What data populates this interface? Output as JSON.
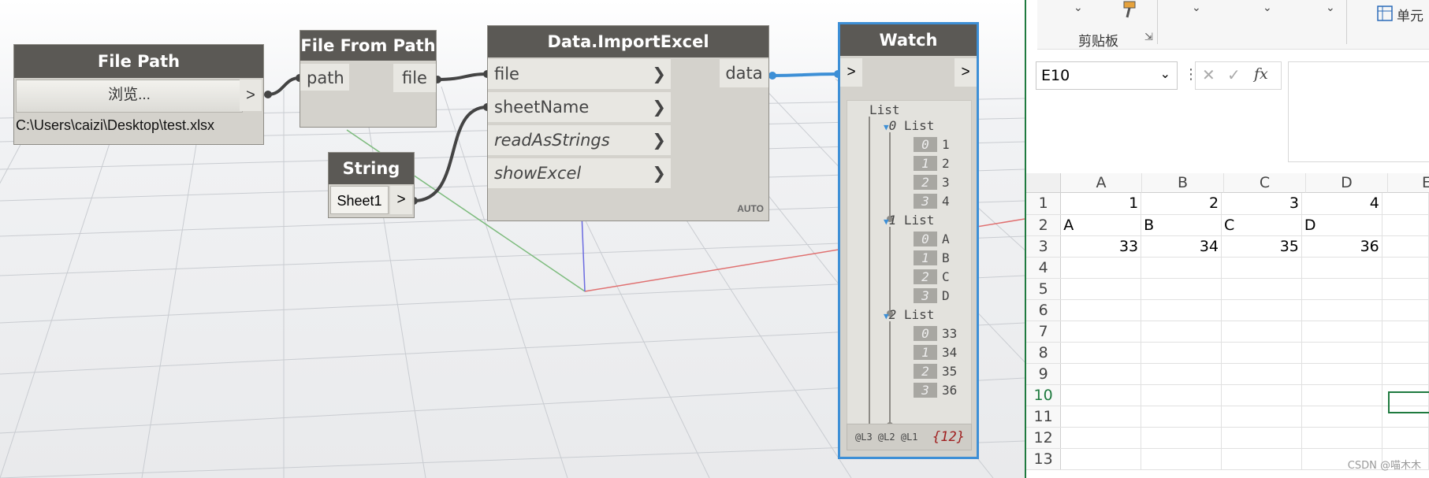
{
  "nodes": {
    "file_path": {
      "title": "File Path",
      "browse_label": "浏览...",
      "output_arrow": ">",
      "path_value": "C:\\Users\\caizi\\Desktop\\test.xlsx"
    },
    "file_from_path": {
      "title": "File From Path",
      "input": "path",
      "output": "file"
    },
    "string": {
      "title": "String",
      "value": "Sheet1",
      "output_arrow": ">"
    },
    "import_excel": {
      "title": "Data.ImportExcel",
      "inputs": [
        "file",
        "sheetName",
        "readAsStrings",
        "showExcel"
      ],
      "output": "data",
      "mode": "AUTO"
    },
    "watch": {
      "title": "Watch",
      "in_arrow": ">",
      "out_arrow": ">",
      "root_label": "List",
      "groups": [
        {
          "index": "0",
          "label": "List",
          "items": [
            {
              "i": "0",
              "v": "1"
            },
            {
              "i": "1",
              "v": "2"
            },
            {
              "i": "2",
              "v": "3"
            },
            {
              "i": "3",
              "v": "4"
            }
          ]
        },
        {
          "index": "1",
          "label": "List",
          "items": [
            {
              "i": "0",
              "v": "A"
            },
            {
              "i": "1",
              "v": "B"
            },
            {
              "i": "2",
              "v": "C"
            },
            {
              "i": "3",
              "v": "D"
            }
          ]
        },
        {
          "index": "2",
          "label": "List",
          "items": [
            {
              "i": "0",
              "v": "33"
            },
            {
              "i": "1",
              "v": "34"
            },
            {
              "i": "2",
              "v": "35"
            },
            {
              "i": "3",
              "v": "36"
            }
          ]
        }
      ],
      "levels": [
        "@L3",
        "@L2",
        "@L1"
      ],
      "count": "{12}"
    }
  },
  "excel": {
    "ribbon_group": "剪贴板",
    "ribbon_partial": "单元",
    "name_box": "E10",
    "fx": "fx",
    "columns": [
      "A",
      "B",
      "C",
      "D",
      "E"
    ],
    "rows": [
      {
        "n": "1",
        "cells": [
          "1",
          "2",
          "3",
          "4"
        ]
      },
      {
        "n": "2",
        "cells": [
          "A",
          "B",
          "C",
          "D"
        ]
      },
      {
        "n": "3",
        "cells": [
          "33",
          "34",
          "35",
          "36"
        ]
      },
      {
        "n": "4",
        "cells": [
          "",
          "",
          "",
          ""
        ]
      },
      {
        "n": "5",
        "cells": [
          "",
          "",
          "",
          ""
        ]
      },
      {
        "n": "6",
        "cells": [
          "",
          "",
          "",
          ""
        ]
      },
      {
        "n": "7",
        "cells": [
          "",
          "",
          "",
          ""
        ]
      },
      {
        "n": "8",
        "cells": [
          "",
          "",
          "",
          ""
        ]
      },
      {
        "n": "9",
        "cells": [
          "",
          "",
          "",
          ""
        ]
      },
      {
        "n": "10",
        "cells": [
          "",
          "",
          "",
          ""
        ]
      },
      {
        "n": "11",
        "cells": [
          "",
          "",
          "",
          ""
        ]
      },
      {
        "n": "12",
        "cells": [
          "",
          "",
          "",
          ""
        ]
      },
      {
        "n": "13",
        "cells": [
          "",
          "",
          "",
          ""
        ]
      }
    ],
    "watermark": "CSDN @喵木木"
  },
  "colors": {
    "node_title_bg": "#5b5955",
    "node_body_bg": "#d4d2cc",
    "selected_border": "#3d8fd6",
    "excel_green": "#1f7a3f"
  }
}
